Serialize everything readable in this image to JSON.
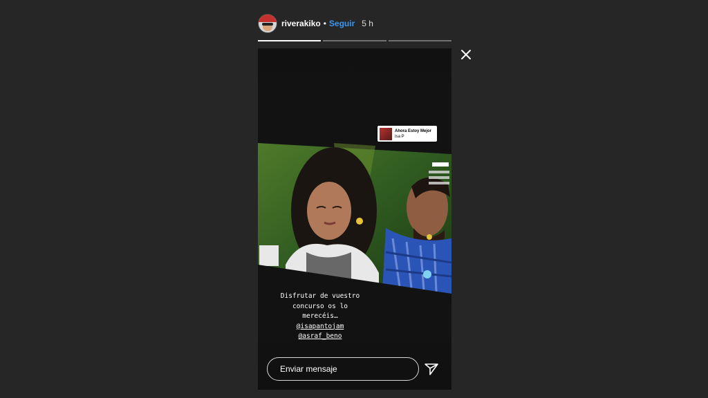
{
  "header": {
    "username": "riverakiko",
    "separator": "•",
    "follow_label": "Seguir",
    "time_ago": "5 h"
  },
  "progress": {
    "segments": [
      1,
      0,
      0
    ]
  },
  "story": {
    "music_sticker": {
      "title": "Ahora Estoy Mejor",
      "artist": "Isa P"
    },
    "caption": {
      "text": "Disfrutar de vuestro concurso os lo merecéis…",
      "mentions": [
        "@isapantojam",
        "@asraf_beno"
      ]
    },
    "reply": {
      "placeholder": "Enviar mensaje"
    }
  },
  "icons": {
    "close": "close-icon",
    "send": "send-icon",
    "avatar": "avatar"
  }
}
